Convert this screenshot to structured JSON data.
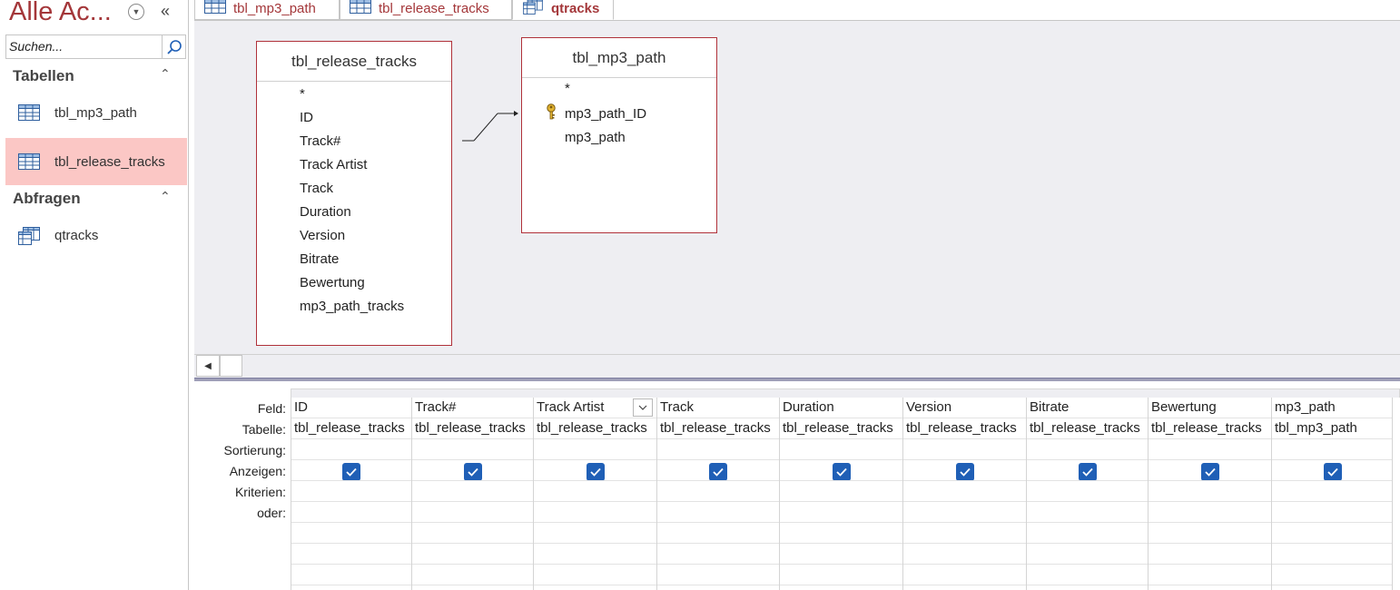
{
  "nav": {
    "title": "Alle Ac...",
    "search_placeholder": "Suchen...",
    "groups": [
      {
        "label": "Tabellen",
        "items": [
          {
            "label": "tbl_mp3_path",
            "selected": false
          },
          {
            "label": "tbl_release_tracks",
            "selected": true
          }
        ]
      },
      {
        "label": "Abfragen",
        "items": [
          {
            "label": "qtracks",
            "selected": false
          }
        ]
      }
    ]
  },
  "tabs": [
    {
      "label": "tbl_mp3_path",
      "icon": "table-icon",
      "active": false
    },
    {
      "label": "tbl_release_tracks",
      "icon": "table-icon",
      "active": false
    },
    {
      "label": "qtracks",
      "icon": "query-icon",
      "active": true
    }
  ],
  "design": {
    "tables": [
      {
        "name": "tbl_release_tracks",
        "fields": [
          "*",
          "ID",
          "Track#",
          "Track Artist",
          "Track",
          "Duration",
          "Version",
          "Bitrate",
          "Bewertung",
          "mp3_path_tracks"
        ]
      },
      {
        "name": "tbl_mp3_path",
        "fields": [
          "*",
          "mp3_path_ID",
          "mp3_path"
        ],
        "primary_key": "mp3_path_ID"
      }
    ]
  },
  "grid": {
    "row_labels": {
      "field": "Feld:",
      "table": "Tabelle:",
      "sort": "Sortierung:",
      "show": "Anzeigen:",
      "criteria": "Kriterien:",
      "or": "oder:"
    },
    "columns": [
      {
        "field": "ID",
        "table": "tbl_release_tracks",
        "show": true
      },
      {
        "field": "Track#",
        "table": "tbl_release_tracks",
        "show": true
      },
      {
        "field": "Track Artist",
        "table": "tbl_release_tracks",
        "show": true
      },
      {
        "field": "Track",
        "table": "tbl_release_tracks",
        "show": true
      },
      {
        "field": "Duration",
        "table": "tbl_release_tracks",
        "show": true
      },
      {
        "field": "Version",
        "table": "tbl_release_tracks",
        "show": true
      },
      {
        "field": "Bitrate",
        "table": "tbl_release_tracks",
        "show": true
      },
      {
        "field": "Bewertung",
        "table": "tbl_release_tracks",
        "show": true
      },
      {
        "field": "mp3_path",
        "table": "tbl_mp3_path",
        "show": true
      }
    ]
  },
  "colors": {
    "accent": "#a4373a",
    "selected_bg": "#fbc7c5",
    "checkbox": "#1f5fb6",
    "canvas_bg": "#eeeef2"
  }
}
